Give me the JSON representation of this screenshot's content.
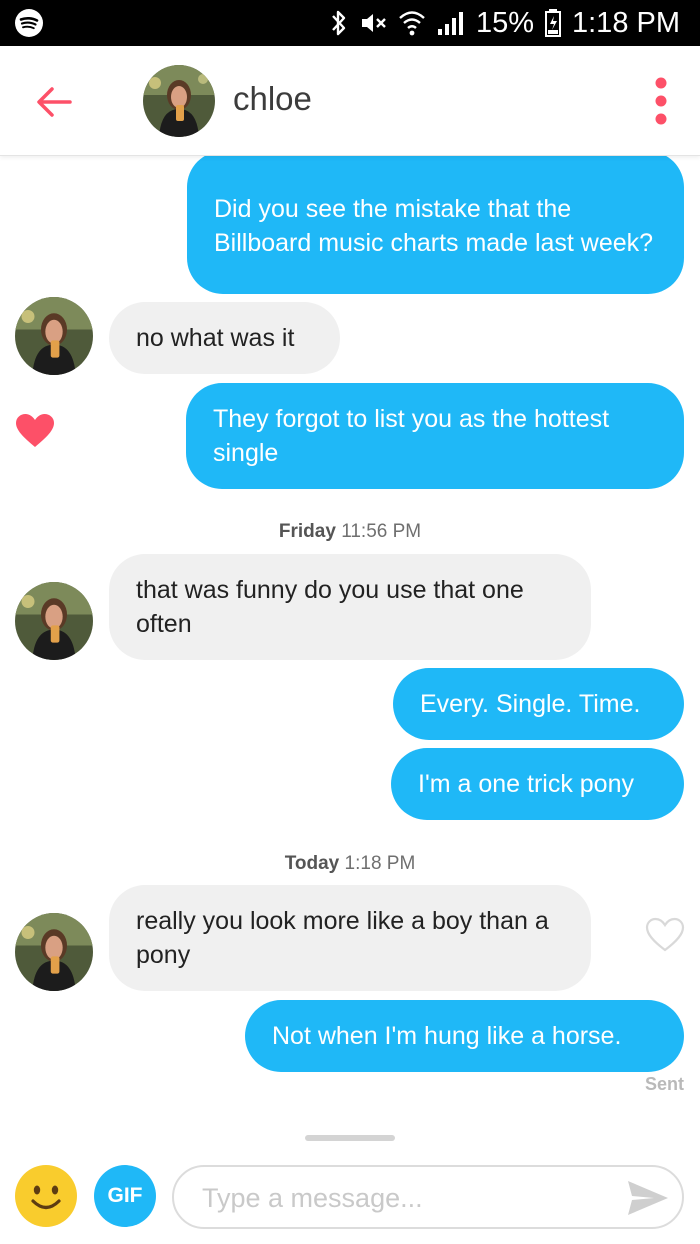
{
  "status_bar": {
    "battery": "15%",
    "time": "1:18 PM"
  },
  "header": {
    "name": "chloe"
  },
  "messages": [
    {
      "type": "sent",
      "text": "Did you see the mistake that the Billboard music charts made last week?"
    },
    {
      "type": "received",
      "text": "no what was it"
    },
    {
      "type": "sent",
      "text": "They forgot to list you as the hottest single",
      "liked": true
    },
    {
      "type": "received",
      "text": "that was funny do you use that one often"
    },
    {
      "type": "sent",
      "text": "Every. Single. Time."
    },
    {
      "type": "sent",
      "text": "I'm a one trick pony"
    },
    {
      "type": "received",
      "text": "really you look more like a boy than a pony",
      "liked": false
    },
    {
      "type": "sent",
      "text": "Not when I'm hung like a horse."
    }
  ],
  "timestamps": [
    {
      "day": "Friday",
      "time": "11:56 PM"
    },
    {
      "day": "Today",
      "time": "1:18 PM"
    }
  ],
  "sent_label": "Sent",
  "composer": {
    "gif_label": "GIF",
    "placeholder": "Type a message..."
  },
  "colors": {
    "sent_bubble": "#1fb8f7",
    "received_bubble": "#f0f0f0",
    "accent": "#fd5068"
  }
}
